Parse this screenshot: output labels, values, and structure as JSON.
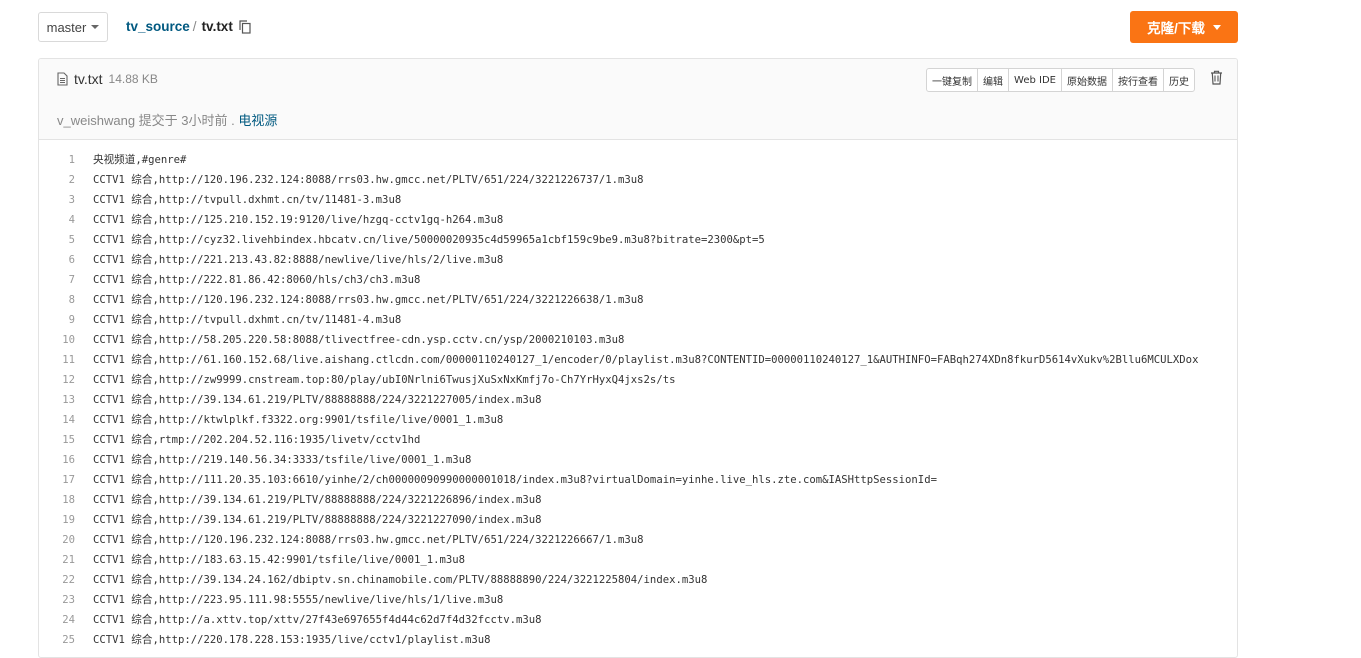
{
  "branch": {
    "label": "master"
  },
  "breadcrumb": {
    "repo": "tv_source",
    "separator": "/",
    "file": "tv.txt"
  },
  "clone_button": {
    "label": "克隆/下载"
  },
  "file": {
    "name": "tv.txt",
    "size": "14.88 KB",
    "actions": [
      "一键复制",
      "编辑",
      "Web IDE",
      "原始数据",
      "按行查看",
      "历史"
    ]
  },
  "commit": {
    "author": "v_weishwang",
    "text": "提交于 3小时前 .",
    "message": "电视源"
  },
  "code_lines": [
    {
      "n": "1",
      "t": "央视频道,#genre#"
    },
    {
      "n": "2",
      "t": "CCTV1 综合,http://120.196.232.124:8088/rrs03.hw.gmcc.net/PLTV/651/224/3221226737/1.m3u8"
    },
    {
      "n": "3",
      "t": "CCTV1 综合,http://tvpull.dxhmt.cn/tv/11481-3.m3u8"
    },
    {
      "n": "4",
      "t": "CCTV1 综合,http://125.210.152.19:9120/live/hzgq-cctv1gq-h264.m3u8"
    },
    {
      "n": "5",
      "t": "CCTV1 综合,http://cyz32.livehbindex.hbcatv.cn/live/50000020935c4d59965a1cbf159c9be9.m3u8?bitrate=2300&pt=5"
    },
    {
      "n": "6",
      "t": "CCTV1 综合,http://221.213.43.82:8888/newlive/live/hls/2/live.m3u8"
    },
    {
      "n": "7",
      "t": "CCTV1 综合,http://222.81.86.42:8060/hls/ch3/ch3.m3u8"
    },
    {
      "n": "8",
      "t": "CCTV1 综合,http://120.196.232.124:8088/rrs03.hw.gmcc.net/PLTV/651/224/3221226638/1.m3u8"
    },
    {
      "n": "9",
      "t": "CCTV1 综合,http://tvpull.dxhmt.cn/tv/11481-4.m3u8"
    },
    {
      "n": "10",
      "t": "CCTV1 综合,http://58.205.220.58:8088/tlivectfree-cdn.ysp.cctv.cn/ysp/2000210103.m3u8"
    },
    {
      "n": "11",
      "t": "CCTV1 综合,http://61.160.152.68/live.aishang.ctlcdn.com/00000110240127_1/encoder/0/playlist.m3u8?CONTENTID=00000110240127_1&AUTHINFO=FABqh274XDn8fkurD5614vXukv%2Bllu6MCULXDox"
    },
    {
      "n": "12",
      "t": "CCTV1 综合,http://zw9999.cnstream.top:80/play/ubI0Nrlni6TwusjXuSxNxKmfj7o-Ch7YrHyxQ4jxs2s/ts"
    },
    {
      "n": "13",
      "t": "CCTV1 综合,http://39.134.61.219/PLTV/88888888/224/3221227005/index.m3u8"
    },
    {
      "n": "14",
      "t": "CCTV1 综合,http://ktwlplkf.f3322.org:9901/tsfile/live/0001_1.m3u8"
    },
    {
      "n": "15",
      "t": "CCTV1 综合,rtmp://202.204.52.116:1935/livetv/cctv1hd"
    },
    {
      "n": "16",
      "t": "CCTV1 综合,http://219.140.56.34:3333/tsfile/live/0001_1.m3u8"
    },
    {
      "n": "17",
      "t": "CCTV1 综合,http://111.20.35.103:6610/yinhe/2/ch00000090990000001018/index.m3u8?virtualDomain=yinhe.live_hls.zte.com&IASHttpSessionId="
    },
    {
      "n": "18",
      "t": "CCTV1 综合,http://39.134.61.219/PLTV/88888888/224/3221226896/index.m3u8"
    },
    {
      "n": "19",
      "t": "CCTV1 综合,http://39.134.61.219/PLTV/88888888/224/3221227090/index.m3u8"
    },
    {
      "n": "20",
      "t": "CCTV1 综合,http://120.196.232.124:8088/rrs03.hw.gmcc.net/PLTV/651/224/3221226667/1.m3u8"
    },
    {
      "n": "21",
      "t": "CCTV1 综合,http://183.63.15.42:9901/tsfile/live/0001_1.m3u8"
    },
    {
      "n": "22",
      "t": "CCTV1 综合,http://39.134.24.162/dbiptv.sn.chinamobile.com/PLTV/88888890/224/3221225804/index.m3u8"
    },
    {
      "n": "23",
      "t": "CCTV1 综合,http://223.95.111.98:5555/newlive/live/hls/1/live.m3u8"
    },
    {
      "n": "24",
      "t": "CCTV1 综合,http://a.xttv.top/xttv/27f43e697655f4d44c62d7f4d32fcctv.m3u8"
    },
    {
      "n": "25",
      "t": "CCTV1 综合,http://220.178.228.153:1935/live/cctv1/playlist.m3u8"
    }
  ]
}
